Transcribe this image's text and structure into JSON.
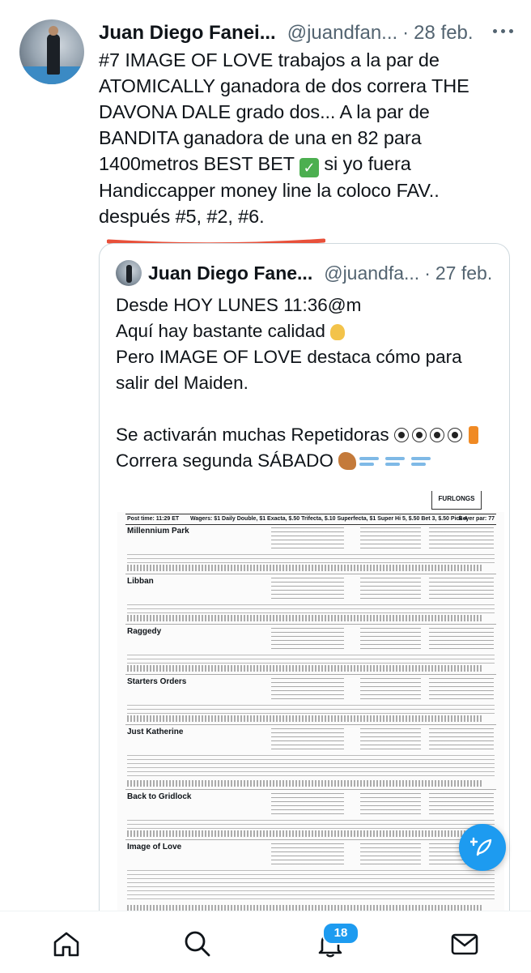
{
  "tweet": {
    "author_name": "Juan Diego Fanei...",
    "author_handle": "@juandfan...",
    "separator": "·",
    "date": "28 feb.",
    "text_line1": "#7 IMAGE OF LOVE trabajos a la par de",
    "text_line2": "ATOMICALLY ganadora de dos correra THE",
    "text_line3": "DAVONA DALE grado dos... A la par de",
    "text_line4": "BANDITA ganadora de una en 82 para",
    "text_line5": "1400metros BEST BET",
    "text_line5_after": " si yo fuera",
    "text_line6": "Handiccapper money line la coloco FAV..",
    "text_line7": "después #5, #2, #6."
  },
  "quoted": {
    "author_name": "Juan Diego Fane...",
    "author_handle": "@juandfa...",
    "separator": "·",
    "date": "27 feb.",
    "line1": "Desde HOY LUNES 11:36@m",
    "line2": "Aquí hay bastante calidad",
    "line3": "Pero IMAGE OF LOVE destaca cómo para",
    "line4": "salir del Maiden.",
    "line5": "Se activarán muchas Repetidoras",
    "line6": "Correra segunda SÁBADO"
  },
  "sheet": {
    "logo": "FURLONGS",
    "post_time": "Post time: 11:29 ET",
    "wagers": "Wagers: $1 Daily Double, $1 Exacta, $.50 Trifecta, $.10 Superfecta, $1 Super Hi 5, $.50 Bet 3, $.50 Pick 4",
    "beyer": "Beyer par: 77",
    "horses": [
      "Millennium Park",
      "Libban",
      "Raggedy",
      "Starters Orders",
      "Just Katherine",
      "Back to Gridlock",
      "Image of Love"
    ]
  },
  "nav": {
    "items": [
      "home-icon",
      "search-icon",
      "notifications-icon",
      "messages-icon"
    ],
    "notification_count": "18"
  },
  "colors": {
    "accent": "#1d9bf0",
    "underline": "#e8503a",
    "text": "#0f1419",
    "muted": "#536471"
  }
}
